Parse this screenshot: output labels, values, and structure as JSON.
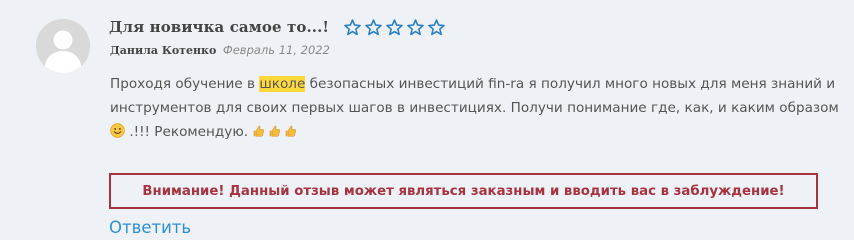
{
  "review": {
    "title": "Для новичка самое то...!",
    "rating": 0,
    "rating_max": 5,
    "author": "Данила Котенко",
    "date": "Февраль 11, 2022",
    "body": {
      "line1_before": "Проходя обучение в ",
      "line1_highlight": "школе",
      "line1_after": " безопасных инвестиций fin-ra я получил много новых для меня знаний и",
      "line2": "инструментов для своих первых шагов в инвестициях. Получи понимание где, как, и каким образом",
      "line3_after_emoji": " .!!! Рекомендую. "
    },
    "emoji": {
      "smiley": "smiley-emoji",
      "thumbs": [
        "thumbs-up-emoji",
        "thumbs-up-emoji",
        "thumbs-up-emoji"
      ]
    }
  },
  "warning": {
    "text": "Внимание! Данный отзыв может являться заказным и вводить вас в заблуждение!"
  },
  "actions": {
    "reply_label": "Ответить"
  },
  "colors": {
    "background": "#eef2f6",
    "star_outline": "#2b7fc4",
    "highlight": "#ffd83b",
    "warning": "#a8323f",
    "link": "#2c8fd6"
  }
}
